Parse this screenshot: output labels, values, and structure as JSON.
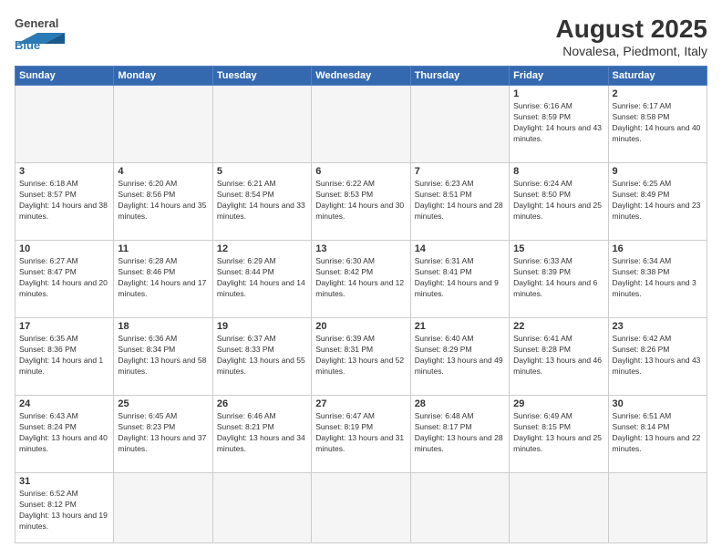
{
  "header": {
    "logo_general": "General",
    "logo_blue": "Blue",
    "month_year": "August 2025",
    "location": "Novalesa, Piedmont, Italy"
  },
  "days_of_week": [
    "Sunday",
    "Monday",
    "Tuesday",
    "Wednesday",
    "Thursday",
    "Friday",
    "Saturday"
  ],
  "weeks": [
    [
      {
        "day": "",
        "info": ""
      },
      {
        "day": "",
        "info": ""
      },
      {
        "day": "",
        "info": ""
      },
      {
        "day": "",
        "info": ""
      },
      {
        "day": "",
        "info": ""
      },
      {
        "day": "1",
        "info": "Sunrise: 6:16 AM\nSunset: 8:59 PM\nDaylight: 14 hours and 43 minutes."
      },
      {
        "day": "2",
        "info": "Sunrise: 6:17 AM\nSunset: 8:58 PM\nDaylight: 14 hours and 40 minutes."
      }
    ],
    [
      {
        "day": "3",
        "info": "Sunrise: 6:18 AM\nSunset: 8:57 PM\nDaylight: 14 hours and 38 minutes."
      },
      {
        "day": "4",
        "info": "Sunrise: 6:20 AM\nSunset: 8:56 PM\nDaylight: 14 hours and 35 minutes."
      },
      {
        "day": "5",
        "info": "Sunrise: 6:21 AM\nSunset: 8:54 PM\nDaylight: 14 hours and 33 minutes."
      },
      {
        "day": "6",
        "info": "Sunrise: 6:22 AM\nSunset: 8:53 PM\nDaylight: 14 hours and 30 minutes."
      },
      {
        "day": "7",
        "info": "Sunrise: 6:23 AM\nSunset: 8:51 PM\nDaylight: 14 hours and 28 minutes."
      },
      {
        "day": "8",
        "info": "Sunrise: 6:24 AM\nSunset: 8:50 PM\nDaylight: 14 hours and 25 minutes."
      },
      {
        "day": "9",
        "info": "Sunrise: 6:25 AM\nSunset: 8:49 PM\nDaylight: 14 hours and 23 minutes."
      }
    ],
    [
      {
        "day": "10",
        "info": "Sunrise: 6:27 AM\nSunset: 8:47 PM\nDaylight: 14 hours and 20 minutes."
      },
      {
        "day": "11",
        "info": "Sunrise: 6:28 AM\nSunset: 8:46 PM\nDaylight: 14 hours and 17 minutes."
      },
      {
        "day": "12",
        "info": "Sunrise: 6:29 AM\nSunset: 8:44 PM\nDaylight: 14 hours and 14 minutes."
      },
      {
        "day": "13",
        "info": "Sunrise: 6:30 AM\nSunset: 8:42 PM\nDaylight: 14 hours and 12 minutes."
      },
      {
        "day": "14",
        "info": "Sunrise: 6:31 AM\nSunset: 8:41 PM\nDaylight: 14 hours and 9 minutes."
      },
      {
        "day": "15",
        "info": "Sunrise: 6:33 AM\nSunset: 8:39 PM\nDaylight: 14 hours and 6 minutes."
      },
      {
        "day": "16",
        "info": "Sunrise: 6:34 AM\nSunset: 8:38 PM\nDaylight: 14 hours and 3 minutes."
      }
    ],
    [
      {
        "day": "17",
        "info": "Sunrise: 6:35 AM\nSunset: 8:36 PM\nDaylight: 14 hours and 1 minute."
      },
      {
        "day": "18",
        "info": "Sunrise: 6:36 AM\nSunset: 8:34 PM\nDaylight: 13 hours and 58 minutes."
      },
      {
        "day": "19",
        "info": "Sunrise: 6:37 AM\nSunset: 8:33 PM\nDaylight: 13 hours and 55 minutes."
      },
      {
        "day": "20",
        "info": "Sunrise: 6:39 AM\nSunset: 8:31 PM\nDaylight: 13 hours and 52 minutes."
      },
      {
        "day": "21",
        "info": "Sunrise: 6:40 AM\nSunset: 8:29 PM\nDaylight: 13 hours and 49 minutes."
      },
      {
        "day": "22",
        "info": "Sunrise: 6:41 AM\nSunset: 8:28 PM\nDaylight: 13 hours and 46 minutes."
      },
      {
        "day": "23",
        "info": "Sunrise: 6:42 AM\nSunset: 8:26 PM\nDaylight: 13 hours and 43 minutes."
      }
    ],
    [
      {
        "day": "24",
        "info": "Sunrise: 6:43 AM\nSunset: 8:24 PM\nDaylight: 13 hours and 40 minutes."
      },
      {
        "day": "25",
        "info": "Sunrise: 6:45 AM\nSunset: 8:23 PM\nDaylight: 13 hours and 37 minutes."
      },
      {
        "day": "26",
        "info": "Sunrise: 6:46 AM\nSunset: 8:21 PM\nDaylight: 13 hours and 34 minutes."
      },
      {
        "day": "27",
        "info": "Sunrise: 6:47 AM\nSunset: 8:19 PM\nDaylight: 13 hours and 31 minutes."
      },
      {
        "day": "28",
        "info": "Sunrise: 6:48 AM\nSunset: 8:17 PM\nDaylight: 13 hours and 28 minutes."
      },
      {
        "day": "29",
        "info": "Sunrise: 6:49 AM\nSunset: 8:15 PM\nDaylight: 13 hours and 25 minutes."
      },
      {
        "day": "30",
        "info": "Sunrise: 6:51 AM\nSunset: 8:14 PM\nDaylight: 13 hours and 22 minutes."
      }
    ],
    [
      {
        "day": "31",
        "info": "Sunrise: 6:52 AM\nSunset: 8:12 PM\nDaylight: 13 hours and 19 minutes."
      },
      {
        "day": "",
        "info": ""
      },
      {
        "day": "",
        "info": ""
      },
      {
        "day": "",
        "info": ""
      },
      {
        "day": "",
        "info": ""
      },
      {
        "day": "",
        "info": ""
      },
      {
        "day": "",
        "info": ""
      }
    ]
  ]
}
